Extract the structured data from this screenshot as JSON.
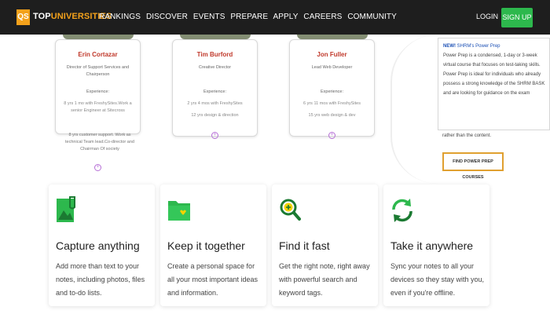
{
  "header": {
    "logo_badge": "QS",
    "logo_prefix": "TOP",
    "logo_suffix": "UNIVERSITIES",
    "nav": [
      "RANKINGS",
      "DISCOVER",
      "EVENTS",
      "PREPARE",
      "APPLY",
      "CAREERS",
      "COMMUNITY"
    ],
    "login": "LOGIN",
    "signup": "SIGN UP"
  },
  "team": [
    {
      "name": "Erin Cortazar",
      "role": "Director of Support Services and Chairperson",
      "experience_heading": "Experience:",
      "experience": [
        "8 yrs 1 mo with FreshySites.Work a senior Engineer at Sitecross"
      ]
    },
    {
      "name": "Tim Burford",
      "role": "Creative Director",
      "experience_heading": "Experience:",
      "experience": [
        "2 yrs 4 mos with FreshySites",
        "12 yrs design & direction"
      ]
    },
    {
      "name": "Jon Fuller",
      "role": "Lead Web Developer",
      "experience_heading": "Experience:",
      "experience": [
        "6 yrs 11 mos with FreshySites",
        "15 yrs web design & dev"
      ]
    }
  ],
  "team_overflow_text": "8 yrs customer support. Work as technical Team lead.Co-director and Chairman Of society",
  "card_toggle_icon": "plus-circle-icon",
  "promo": {
    "new_label": "NEW!",
    "title": "SHRM's Power Prep",
    "body": "Power Prep is a condensed, 1-day or 3-week virtual course that focuses on test-taking skills. Power Prep is ideal for individuals who already possess a strong knowledge of the SHRM BASK and are looking for guidance on the exam",
    "tail": "rather than the content.",
    "button": "FIND POWER PREP COURSES"
  },
  "features": [
    {
      "icon": "photo-clip-icon",
      "title": "Capture anything",
      "desc": "Add more than text to your notes, including photos, files and to-do lists."
    },
    {
      "icon": "folder-heart-icon",
      "title": "Keep it together",
      "desc": "Create a personal space for all your most important ideas and information."
    },
    {
      "icon": "search-plus-icon",
      "title": "Find it fast",
      "desc": "Get the right note, right away with powerful search and keyword tags."
    },
    {
      "icon": "sync-icon",
      "title": "Take it anywhere",
      "desc": "Sync your notes to all your devices so they stay with you, even if you're offline."
    }
  ],
  "colors": {
    "header_bg": "#1e1e1e",
    "brand_orange": "#f3a11b",
    "signup_green": "#2db84d",
    "name_red": "#c0392b",
    "feature_green": "#2db84d",
    "accent_purple": "#b66fd6"
  }
}
